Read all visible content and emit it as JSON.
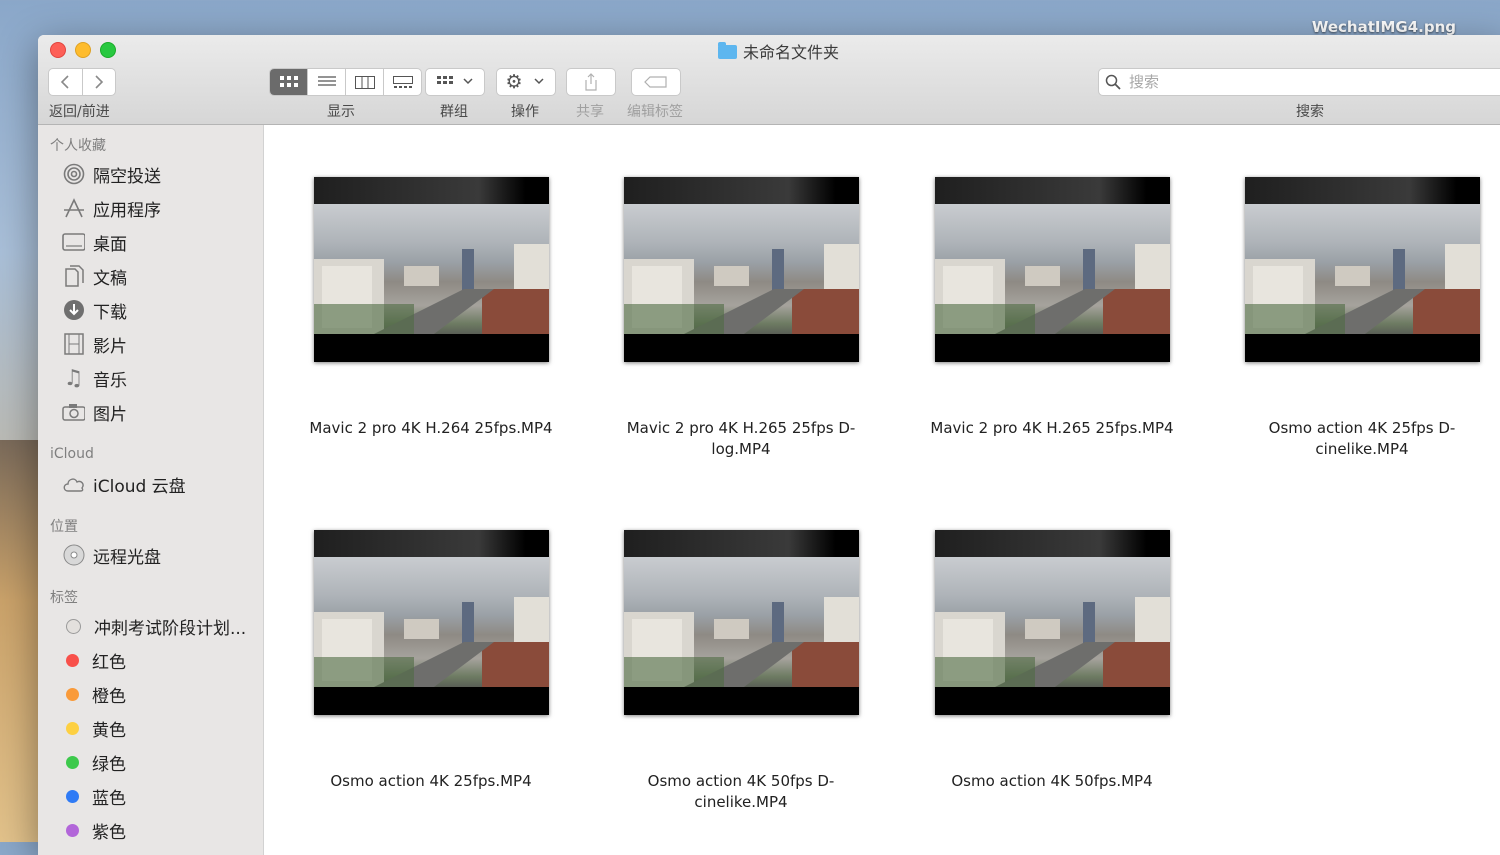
{
  "desktop": {
    "file_label": "WechatIMG4.png"
  },
  "window": {
    "title": "未命名文件夹"
  },
  "toolbar": {
    "back_forward_label": "返回/前进",
    "view_label": "显示",
    "group_label": "群组",
    "action_label": "操作",
    "share_label": "共享",
    "edit_tags_label": "编辑标签",
    "search_label": "搜索",
    "search_placeholder": "搜索"
  },
  "sidebar": {
    "favorites_header": "个人收藏",
    "favorites": [
      {
        "label": "隔空投送",
        "icon": "airdrop-icon"
      },
      {
        "label": "应用程序",
        "icon": "applications-icon"
      },
      {
        "label": "桌面",
        "icon": "desktop-icon"
      },
      {
        "label": "文稿",
        "icon": "documents-icon"
      },
      {
        "label": "下载",
        "icon": "downloads-icon"
      },
      {
        "label": "影片",
        "icon": "movies-icon"
      },
      {
        "label": "音乐",
        "icon": "music-icon"
      },
      {
        "label": "图片",
        "icon": "pictures-icon"
      }
    ],
    "icloud_header": "iCloud",
    "icloud_items": [
      {
        "label": "iCloud 云盘",
        "icon": "cloud-icon"
      }
    ],
    "locations_header": "位置",
    "locations": [
      {
        "label": "远程光盘",
        "icon": "disc-icon"
      }
    ],
    "tags_header": "标签",
    "tags": [
      {
        "label": "冲刺考试阶段计划...",
        "color": "#e3e0dd"
      },
      {
        "label": "红色",
        "color": "#f8504a"
      },
      {
        "label": "橙色",
        "color": "#f99a39"
      },
      {
        "label": "黄色",
        "color": "#fdd042"
      },
      {
        "label": "绿色",
        "color": "#3dc94c"
      },
      {
        "label": "蓝色",
        "color": "#2f7bf5"
      },
      {
        "label": "紫色",
        "color": "#b266d9"
      }
    ]
  },
  "files": [
    {
      "name": "Mavic 2 pro 4K H.264 25fps.MP4"
    },
    {
      "name": "Mavic 2 pro 4K H.265 25fps D-log.MP4"
    },
    {
      "name": "Mavic 2 pro 4K H.265 25fps.MP4"
    },
    {
      "name": "Osmo action 4K  25fps D-cinelike.MP4"
    },
    {
      "name": "Osmo action 4K  25fps.MP4"
    },
    {
      "name": "Osmo action 4K  50fps D-cinelike.MP4"
    },
    {
      "name": "Osmo action 4K  50fps.MP4"
    }
  ]
}
